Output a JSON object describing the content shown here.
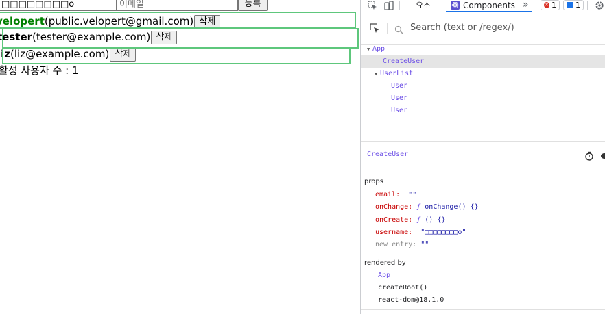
{
  "app": {
    "username_value": "□□□□□□□□o",
    "email_placeholder": "이메일",
    "register_label": "등록",
    "users": [
      {
        "username": "velopert",
        "email": "public.velopert@gmail.com",
        "delete_label": "삭제",
        "active": true
      },
      {
        "username": "tester",
        "email": "tester@example.com",
        "delete_label": "삭제",
        "active": false
      },
      {
        "username": "liz",
        "email": "liz@example.com",
        "delete_label": "삭제",
        "active": false
      }
    ],
    "active_count_text": "활성 사용자 수 : 1",
    "colors": {
      "active_user": "#008000",
      "highlight": "#5ec77c"
    }
  },
  "devtools": {
    "tabs": {
      "elements": "요소",
      "components": "Components",
      "more": "»"
    },
    "badges": {
      "errors": "1",
      "messages": "1"
    },
    "icons": [
      "inspect-icon",
      "device-toggle-icon",
      "react-icon",
      "error-icon",
      "message-icon",
      "settings-gear-icon",
      "search-icon"
    ],
    "search_placeholder": "Search (text or /regex/)",
    "tree": [
      {
        "label": "App",
        "arrow": "▼",
        "depth": 0,
        "selected": false
      },
      {
        "label": "CreateUser",
        "arrow": "",
        "depth": 1,
        "selected": true
      },
      {
        "label": "UserList",
        "arrow": "▼",
        "depth": 1,
        "selected": false
      },
      {
        "label": "User",
        "arrow": "",
        "depth": 2,
        "selected": false
      },
      {
        "label": "User",
        "arrow": "",
        "depth": 2,
        "selected": false
      },
      {
        "label": "User",
        "arrow": "",
        "depth": 2,
        "selected": false
      }
    ],
    "inspected": "CreateUser",
    "props_title": "props",
    "props": {
      "email": {
        "key": "email:",
        "value": "\"\""
      },
      "onChange": {
        "key": "onChange:",
        "f": "ƒ",
        "value": "onChange() {}"
      },
      "onCreate": {
        "key": "onCreate:",
        "f": "ƒ",
        "value": "() {}"
      },
      "username": {
        "key": "username:",
        "value": "\"□□□□□□□□o\""
      },
      "new_entry": {
        "key": "new entry:",
        "value": "\"\""
      }
    },
    "rendered_by_title": "rendered by",
    "rendered_by": [
      "App",
      "createRoot()",
      "react-dom@18.1.0"
    ]
  }
}
